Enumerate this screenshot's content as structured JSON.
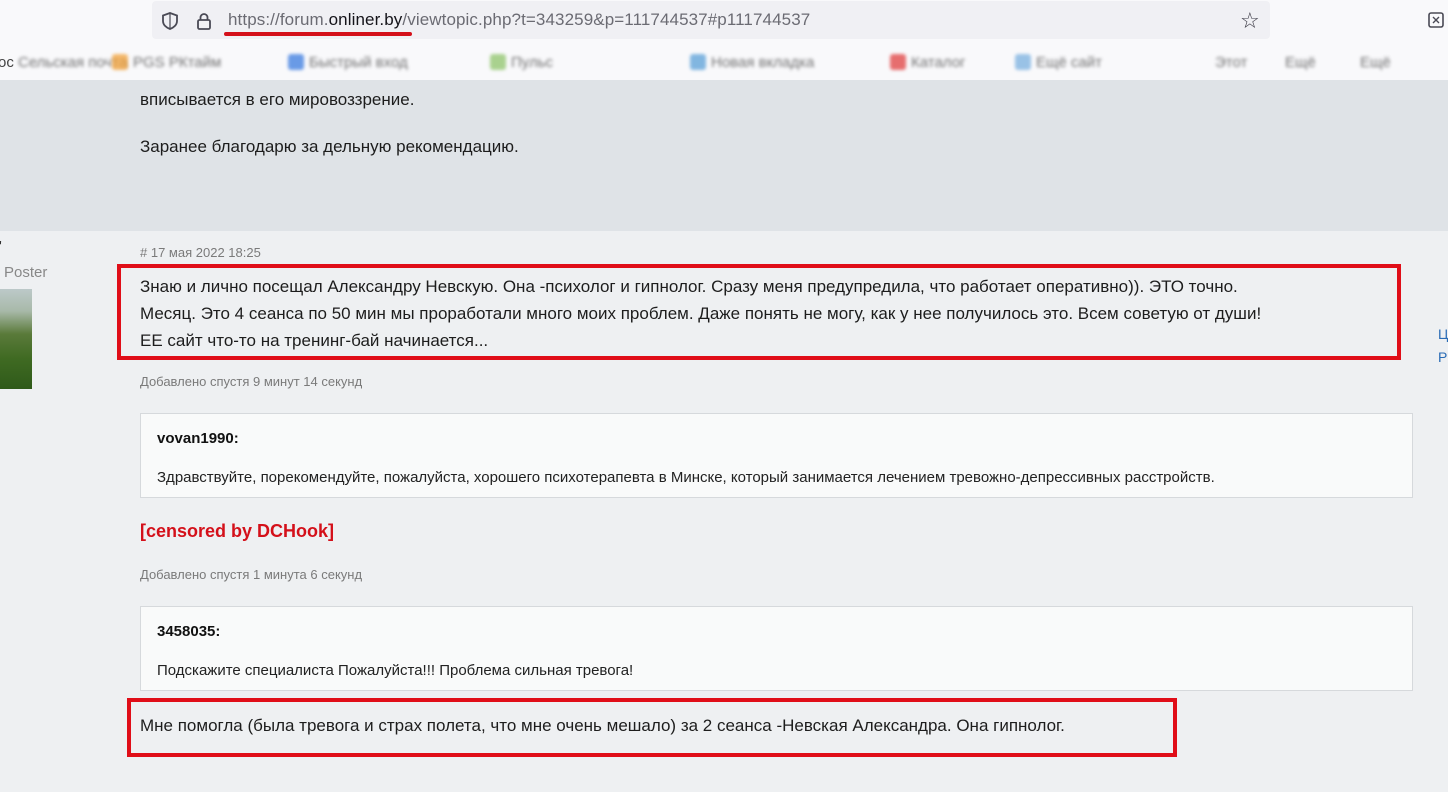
{
  "browser": {
    "url_prefix": "https://forum.",
    "url_domain": "onliner.by",
    "url_suffix": "/viewtopic.php?t=343259&p=111744537#p111744537",
    "star_glyph": "☆",
    "bookmarks": [
      "ос",
      "Сельская почта",
      "PGS РКтайм",
      "Быстрый вход",
      "Пульс",
      "Новая вкладка",
      "Каталог",
      "Ещё сайт",
      "Этот",
      "Ещё",
      "Ещё"
    ]
  },
  "page": {
    "prev_post": {
      "line1": "вписывается в его мировоззрение.",
      "line2": "Заранее благодарю за дельную рекомендацию."
    },
    "sidebar": {
      "tick": "'",
      "rank": "Poster"
    },
    "right_links": [
      "Ц",
      "Р"
    ],
    "post": {
      "anchor": "#",
      "date": "17 мая 2022 18:25",
      "message_lines": [
        "Знаю и лично посещал Александру Невскую. Она -психолог и гипнолог. Сразу меня предупредила, что работает оперативно)). ЭТО точно.",
        "Месяц. Это 4 сеанса по 50 мин мы проработали много моих проблем. Даже понять не могу, как у нее получилось это. Всем советую от души!",
        "ЕЕ сайт что-то на тренинг-бай начинается..."
      ],
      "added1": "Добавлено спустя 9 минут 14 секунд",
      "quote1": {
        "author": "vovan1990:",
        "text": "Здравствуйте, порекомендуйте, пожалуйста, хорошего психотерапевта в Минске, который занимается лечением тревожно-депрессивных расстройств."
      },
      "censored": "[censored by DCHook]",
      "added2": "Добавлено спустя 1 минута 6 секунд",
      "quote2": {
        "author": "3458035:",
        "text": "Подскажите специалиста Пожалуйста!!! Проблема сильная тревога!"
      },
      "final_message": "Мне помогла (была тревога и страх полета, что мне очень мешало) за 2 сеанса -Невская Александра. Она гипнолог."
    }
  },
  "colors": {
    "highlight": "#e00e18",
    "censored": "#d4101a",
    "post_bg": "#eef0f2",
    "prev_post_bg": "#dfe3e7"
  }
}
